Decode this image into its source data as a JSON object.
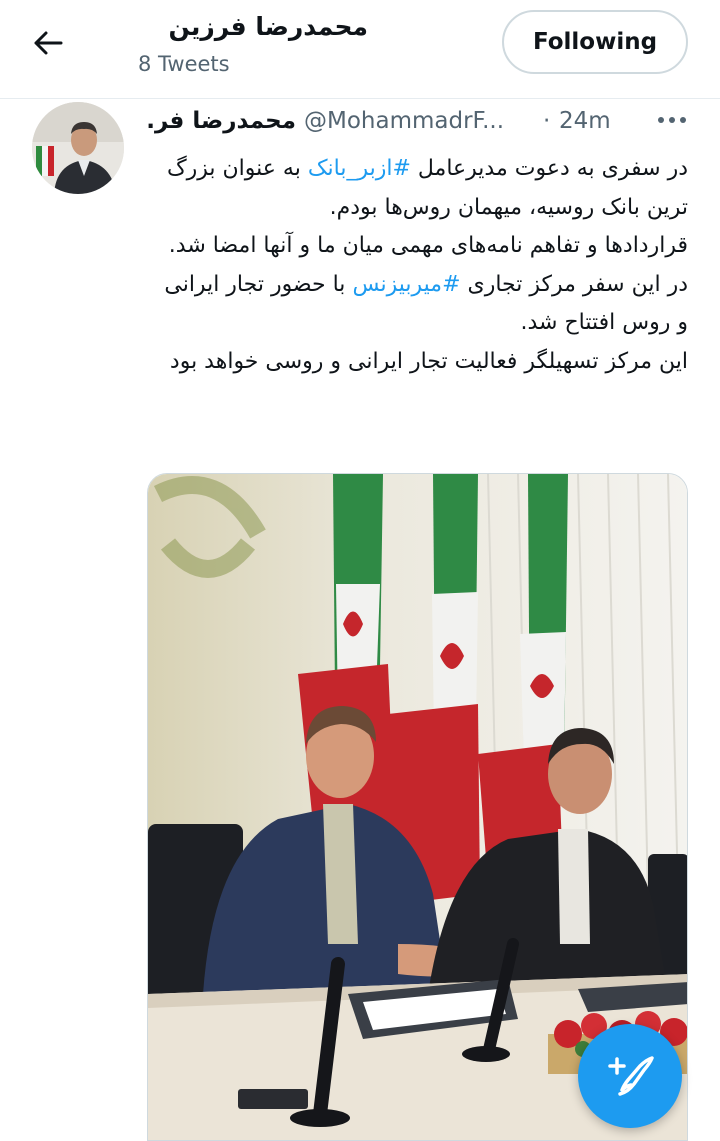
{
  "header": {
    "title": "محمدرضا فرزین",
    "tweet_count": "8 Tweets",
    "follow_label": "Following"
  },
  "tweet": {
    "display_name": "محمدرضا فر...",
    "handle": "@MohammadrF...",
    "separator": "·",
    "time": "24m",
    "paragraphs": [
      {
        "before": "در سفری به دعوت مدیرعامل ",
        "hashtag": "#ازبر_بانک",
        "after": " به عنوان بزرگ ترین بانک روسیه، میهمان روس‌ها بودم."
      },
      {
        "before": "قراردادها و تفاهم نامه‌های مهمی میان ما و آنها امضا شد.",
        "hashtag": "",
        "after": ""
      },
      {
        "before": "در این سفر مرکز تجاری ",
        "hashtag": "#میربیزنس",
        "after": " با حضور تجار ایرانی و روس افتتاح شد."
      },
      {
        "before": "این مرکز تسهیلگر فعالیت تجار ایرانی و روسی خواهد بود",
        "hashtag": "",
        "after": ""
      }
    ]
  },
  "icons": {
    "back": "arrow-left-icon",
    "more": "more-horizontal-icon",
    "compose": "compose-tweet-icon"
  },
  "colors": {
    "accent": "#1d9bf0",
    "text": "#0f1419",
    "secondary": "#536471"
  }
}
